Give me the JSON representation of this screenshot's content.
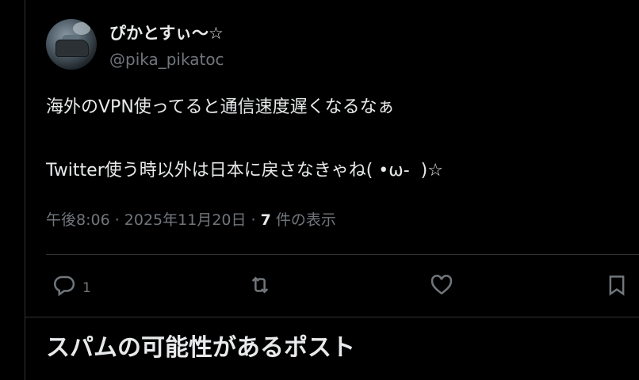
{
  "tweet": {
    "display_name": "ぴかとすぃ〜☆",
    "handle": "@pika_pikatoc",
    "text_lines": [
      "海外のVPN使ってると通信速度遅くなるなぁ",
      "",
      "Twitter使う時以外は日本に戻さなきゃね( •ω-  )☆"
    ],
    "meta": {
      "time": "午後8:06",
      "separator": " · ",
      "date": "2025年11月20日",
      "views_count": "7",
      "views_label": " 件の表示"
    },
    "actions": {
      "reply_icon": "reply-icon",
      "reply_count": "1",
      "retweet_icon": "retweet-icon",
      "like_icon": "heart-icon",
      "bookmark_icon": "bookmark-icon"
    }
  },
  "section": {
    "title": "スパムの可能性があるポスト"
  },
  "colors": {
    "background": "#000000",
    "text_primary": "#e7e9ea",
    "text_secondary": "#71767b",
    "border": "#2f3336"
  }
}
